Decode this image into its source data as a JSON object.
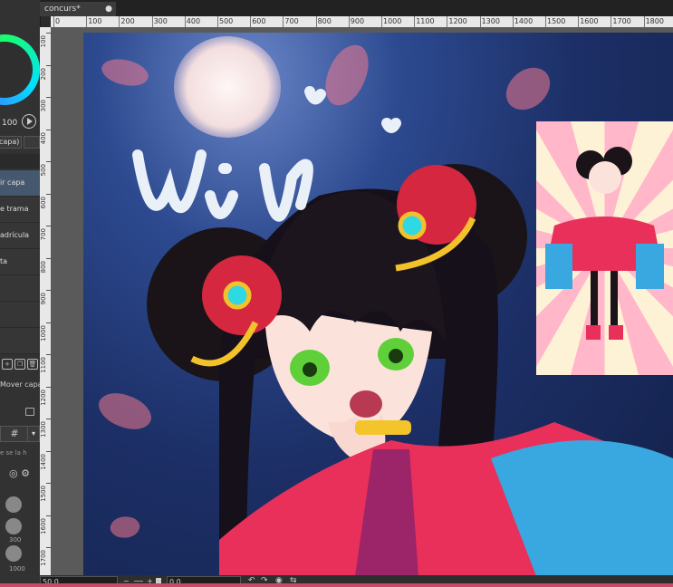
{
  "document": {
    "tab_title": "concurs*",
    "tab_close": "●"
  },
  "colors": {
    "accent": "#46586e",
    "ui_background": "#2b2b2b",
    "ruler": "#e8e8e8",
    "canvas_sky": "#2d4a90"
  },
  "left_panel": {
    "opacity_value": "100",
    "blend_mode_partial": "capa)",
    "layer_items": [
      {
        "label": "ir capa",
        "selected": true
      },
      {
        "label": "e trama",
        "selected": false
      },
      {
        "label": "adrícula",
        "selected": false
      },
      {
        "label": "ta",
        "selected": false
      },
      {
        "label": "",
        "selected": false
      },
      {
        "label": "",
        "selected": false
      },
      {
        "label": "",
        "selected": false
      }
    ],
    "mover_label": "Mover capa",
    "hint_text": "e se la h",
    "brush_sizes": [
      "300",
      "1000"
    ]
  },
  "rulers": {
    "horizontal": [
      "0",
      "100",
      "200",
      "300",
      "400",
      "500",
      "600",
      "700",
      "800",
      "900",
      "1000",
      "1100",
      "1200",
      "1300",
      "1400",
      "1500",
      "1600",
      "1700",
      "1800"
    ],
    "vertical": [
      "100",
      "200",
      "300",
      "400",
      "500",
      "600",
      "700",
      "800",
      "900",
      "1000",
      "1100",
      "1200",
      "1300",
      "1400",
      "1500",
      "1600",
      "1700"
    ]
  },
  "status_bar": {
    "zoom": "50.0",
    "angle": "0.0"
  }
}
